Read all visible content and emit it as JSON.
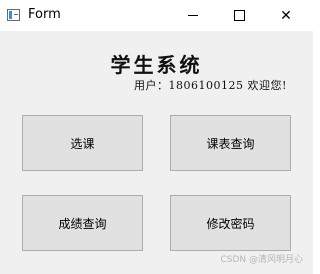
{
  "window": {
    "title": "Form",
    "icon": "app-window-icon",
    "controls": {
      "minimize": "minimize-icon",
      "maximize": "maximize-icon",
      "close": "✕"
    }
  },
  "header": {
    "title": "学生系统",
    "user_line": "用户：1806100125 欢迎您!"
  },
  "buttons": [
    {
      "label": "选课"
    },
    {
      "label": "课表查询"
    },
    {
      "label": "成绩查询"
    },
    {
      "label": "修改密码"
    }
  ],
  "watermark": "CSDN @清风明月心"
}
